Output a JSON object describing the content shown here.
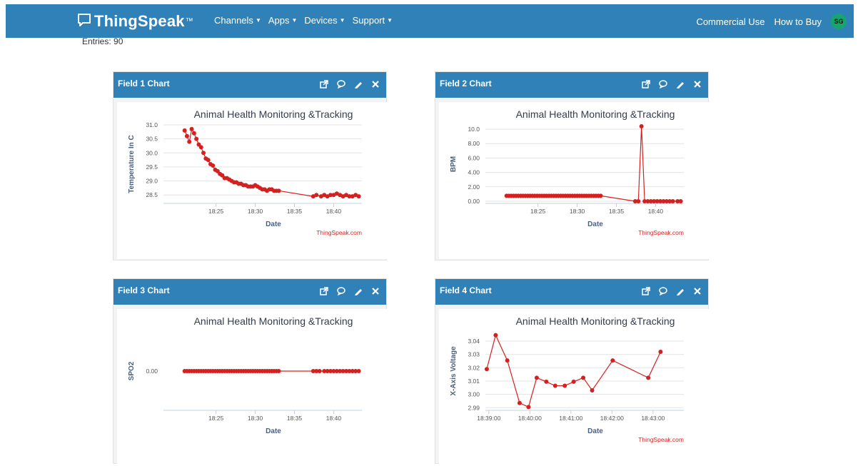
{
  "nav": {
    "brand": "ThingSpeak",
    "brand_tm": "™",
    "menu": [
      "Channels",
      "Apps",
      "Devices",
      "Support"
    ],
    "right": [
      "Commercial Use",
      "How to Buy"
    ],
    "avatar": "SG",
    "colors": {
      "bar": "#2f81b7",
      "avatar": "#17a56e"
    }
  },
  "entries_text": "Entries: 90",
  "panels": [
    {
      "title": "Field 1 Chart"
    },
    {
      "title": "Field 2 Chart"
    },
    {
      "title": "Field 3 Chart"
    },
    {
      "title": "Field 4 Chart"
    }
  ],
  "panel_icons": [
    "external-link-icon",
    "comment-icon",
    "pencil-icon",
    "close-icon"
  ],
  "chart_data": [
    {
      "type": "line",
      "title": "Animal Health Monitoring &Tracking",
      "xlabel": "Date",
      "ylabel": "Temperature In C",
      "credit": "ThingSpeak.com",
      "x_unit": "minute",
      "xlim": [
        18.3,
        43.6
      ],
      "ylim": [
        28.2,
        31.0
      ],
      "yticks": [
        28.5,
        29.0,
        29.5,
        30.0,
        30.5,
        31.0
      ],
      "ytick_labels": [
        "28.5",
        "29.0",
        "29.5",
        "30.0",
        "30.5",
        "31.0"
      ],
      "xticks": [
        25,
        30,
        35,
        40
      ],
      "xtick_labels": [
        "18:25",
        "18:30",
        "18:35",
        "18:40"
      ],
      "grid": true,
      "color": "#d62020",
      "x": [
        21.0,
        21.3,
        21.6,
        21.9,
        22.2,
        22.5,
        22.8,
        23.1,
        23.4,
        23.7,
        24.0,
        24.3,
        24.6,
        24.9,
        25.2,
        25.5,
        25.8,
        26.1,
        26.4,
        26.7,
        27.0,
        27.3,
        27.6,
        27.9,
        28.2,
        28.5,
        28.8,
        29.1,
        29.4,
        29.7,
        30.0,
        30.3,
        30.6,
        30.9,
        31.2,
        31.5,
        31.8,
        32.1,
        32.4,
        32.7,
        33.0,
        37.4,
        37.8,
        38.4,
        38.8,
        39.2,
        39.6,
        40.0,
        40.4,
        40.8,
        41.2,
        41.6,
        42.0,
        42.4,
        42.8,
        43.2
      ],
      "y": [
        30.8,
        30.6,
        30.4,
        30.85,
        30.7,
        30.5,
        30.3,
        30.2,
        30.0,
        29.8,
        29.75,
        29.6,
        29.55,
        29.4,
        29.35,
        29.25,
        29.2,
        29.1,
        29.1,
        29.05,
        29.0,
        28.95,
        28.95,
        28.9,
        28.9,
        28.85,
        28.85,
        28.8,
        28.8,
        28.8,
        28.85,
        28.8,
        28.75,
        28.7,
        28.7,
        28.65,
        28.7,
        28.7,
        28.65,
        28.65,
        28.65,
        28.45,
        28.5,
        28.45,
        28.5,
        28.45,
        28.5,
        28.5,
        28.55,
        28.5,
        28.45,
        28.5,
        28.45,
        28.45,
        28.5,
        28.45
      ]
    },
    {
      "type": "line",
      "title": "Animal Health Monitoring &Tracking",
      "xlabel": "Date",
      "ylabel": "BPM",
      "credit": "ThingSpeak.com",
      "x_unit": "minute",
      "xlim": [
        18.3,
        43.6
      ],
      "ylim": [
        -0.3,
        10.6
      ],
      "yticks": [
        0,
        2,
        4,
        6,
        8,
        10
      ],
      "ytick_labels": [
        "0.00",
        "2.00",
        "4.00",
        "6.00",
        "8.00",
        "10.0"
      ],
      "xticks": [
        25,
        30,
        35,
        40
      ],
      "xtick_labels": [
        "18:25",
        "18:30",
        "18:35",
        "18:40"
      ],
      "grid": true,
      "color": "#d62020",
      "x": [
        21.0,
        21.3,
        21.6,
        21.9,
        22.2,
        22.5,
        22.8,
        23.1,
        23.4,
        23.7,
        24.0,
        24.3,
        24.6,
        24.9,
        25.2,
        25.5,
        25.8,
        26.1,
        26.4,
        26.7,
        27.0,
        27.3,
        27.6,
        27.9,
        28.2,
        28.5,
        28.8,
        29.1,
        29.4,
        29.7,
        30.0,
        30.3,
        30.6,
        30.9,
        31.2,
        31.5,
        31.8,
        32.1,
        32.4,
        32.7,
        33.0,
        37.4,
        37.8,
        38.2,
        38.6,
        39.0,
        39.4,
        39.8,
        40.2,
        40.6,
        41.0,
        41.4,
        41.8,
        42.2,
        42.8,
        43.2
      ],
      "y": [
        0.75,
        0.75,
        0.75,
        0.75,
        0.75,
        0.75,
        0.75,
        0.75,
        0.75,
        0.75,
        0.75,
        0.75,
        0.75,
        0.75,
        0.75,
        0.75,
        0.75,
        0.75,
        0.75,
        0.75,
        0.75,
        0.75,
        0.75,
        0.75,
        0.75,
        0.75,
        0.75,
        0.75,
        0.75,
        0.75,
        0.75,
        0.75,
        0.75,
        0.75,
        0.75,
        0.75,
        0.75,
        0.75,
        0.75,
        0.75,
        0.75,
        0.0,
        0.0,
        10.4,
        0.0,
        0.0,
        0.0,
        0.0,
        0.0,
        0.0,
        0.0,
        0.0,
        0.0,
        0.0,
        0.0,
        0.0
      ]
    },
    {
      "type": "line",
      "title": "Animal Health Monitoring &Tracking",
      "xlabel": "Date",
      "ylabel": "SPO2",
      "credit": "",
      "x_unit": "minute",
      "xlim": [
        18.3,
        43.6
      ],
      "ylim": [
        -0.1,
        0.1
      ],
      "yticks": [
        0
      ],
      "ytick_labels": [
        "0.00"
      ],
      "xticks": [
        25,
        30,
        35,
        40
      ],
      "xtick_labels": [
        "18:25",
        "18:30",
        "18:35",
        "18:40"
      ],
      "grid": false,
      "color": "#d62020",
      "x": [
        21.0,
        21.3,
        21.6,
        21.9,
        22.2,
        22.5,
        22.8,
        23.1,
        23.4,
        23.7,
        24.0,
        24.3,
        24.6,
        24.9,
        25.2,
        25.5,
        25.8,
        26.1,
        26.4,
        26.7,
        27.0,
        27.3,
        27.6,
        27.9,
        28.2,
        28.5,
        28.8,
        29.1,
        29.4,
        29.7,
        30.0,
        30.3,
        30.6,
        30.9,
        31.2,
        31.5,
        31.8,
        32.1,
        32.4,
        32.7,
        33.0,
        37.4,
        37.8,
        38.2,
        38.8,
        39.2,
        39.6,
        40.0,
        40.4,
        40.8,
        41.2,
        41.6,
        42.0,
        42.4,
        42.8,
        43.2
      ],
      "y": [
        0,
        0,
        0,
        0,
        0,
        0,
        0,
        0,
        0,
        0,
        0,
        0,
        0,
        0,
        0,
        0,
        0,
        0,
        0,
        0,
        0,
        0,
        0,
        0,
        0,
        0,
        0,
        0,
        0,
        0,
        0,
        0,
        0,
        0,
        0,
        0,
        0,
        0,
        0,
        0,
        0,
        0,
        0,
        0,
        0,
        0,
        0,
        0,
        0,
        0,
        0,
        0,
        0,
        0,
        0,
        0
      ]
    },
    {
      "type": "line",
      "title": "Animal Health Monitoring &Tracking",
      "xlabel": "Date",
      "ylabel": "X-Axis Voltage",
      "credit": "ThingSpeak.com",
      "x_unit": "second",
      "xlim": [
        2335,
        2625
      ],
      "ylim": [
        2.988,
        3.047
      ],
      "yticks": [
        2.99,
        3.0,
        3.01,
        3.02,
        3.03,
        3.04
      ],
      "ytick_labels": [
        "2.99",
        "3.00",
        "3.01",
        "3.02",
        "3.03",
        "3.04"
      ],
      "xticks": [
        2340,
        2400,
        2460,
        2520,
        2580
      ],
      "xtick_labels": [
        "18:39:00",
        "18:40:00",
        "18:41:00",
        "18:42:00",
        "18:43:00"
      ],
      "grid": true,
      "color": "#d62020",
      "x": [
        2337,
        2350,
        2367,
        2385,
        2398,
        2410,
        2424,
        2437,
        2451,
        2464,
        2478,
        2491,
        2521,
        2573,
        2591
      ],
      "y": [
        3.019,
        3.0445,
        3.0255,
        2.9935,
        2.9905,
        3.0125,
        3.0095,
        3.0065,
        3.0065,
        3.0095,
        3.0125,
        3.003,
        3.0255,
        3.0125,
        3.032
      ]
    }
  ]
}
